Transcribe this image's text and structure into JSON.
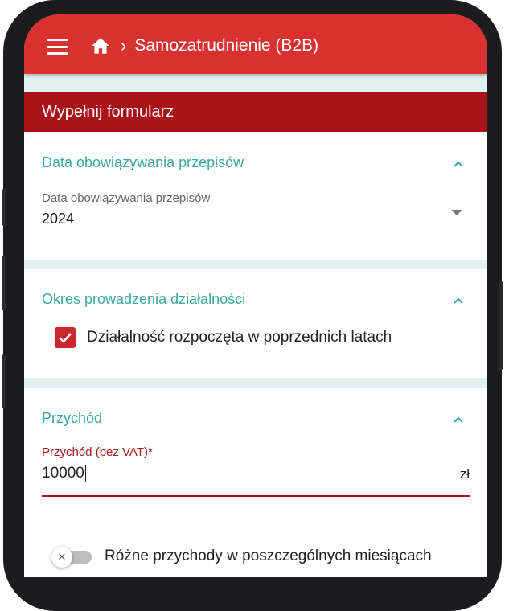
{
  "appbar": {
    "menu_icon": "hamburger-menu-icon",
    "home_icon": "home-icon",
    "separator": "›",
    "title": "Samozatrudnienie (B2B)"
  },
  "form": {
    "header": "Wypełnij formularz",
    "sections": {
      "regulations": {
        "title": "Data obowiązywania przepisów",
        "field_label": "Data obowiązywania przepisów",
        "field_value": "2024"
      },
      "activity": {
        "title": "Okres prowadzenia działalności",
        "checkbox_label": "Działalność rozpoczęta w poprzednich latach",
        "checkbox_checked": true
      },
      "income": {
        "title": "Przychód",
        "field_label": "Przychód (bez VAT)*",
        "field_value": "10000",
        "unit": "zł",
        "toggle_label": "Różne przychody w poszczególnych miesiącach",
        "toggle_on": false,
        "toggle_glyph": "✕"
      }
    }
  },
  "colors": {
    "appbar": "#d93030",
    "header_band": "#a8131a",
    "section_title": "#3aa6a0",
    "checkbox": "#c8282e",
    "background": "#e2f0f0"
  }
}
